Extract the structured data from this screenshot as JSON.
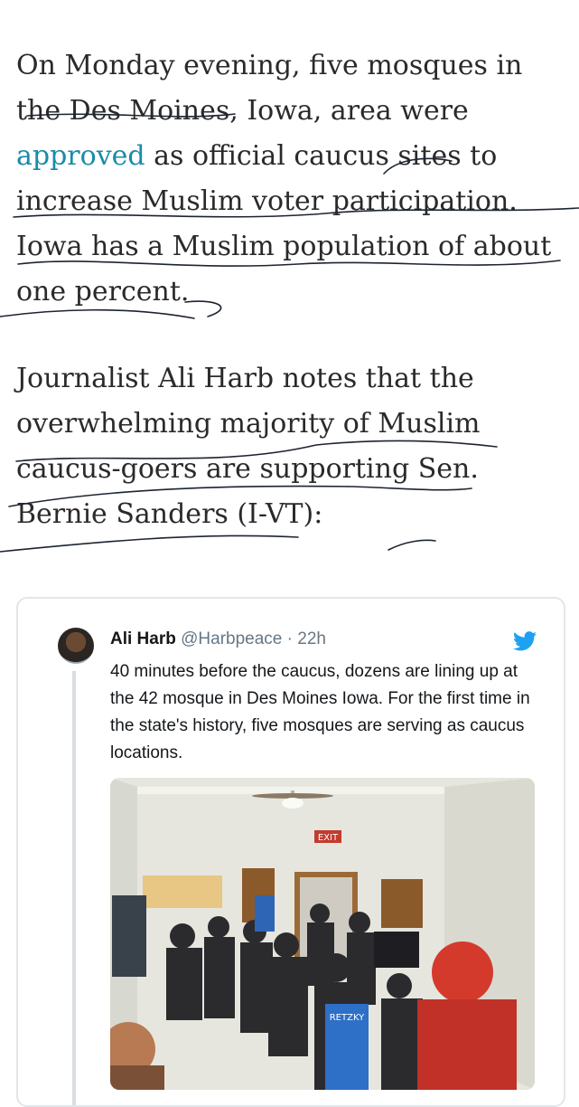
{
  "article": {
    "p1_before_link": "On Monday evening, five mosques in the Des Moines, Iowa, area were ",
    "p1_link": "approved",
    "p1_after_link": " as official caucus sites to increase Muslim voter participation. Iowa has a Muslim population of about one percent.",
    "p2": "Journalist Ali Harb notes that the overwhelming majority of Muslim caucus-goers are supporting Sen. Bernie Sanders (I-VT):"
  },
  "tweet": {
    "name": "Ali Harb",
    "handle": "@Harbpeace",
    "separator": " · ",
    "time": "22h",
    "text": "40 minutes before the caucus, dozens are lining up at the 42 mosque in Des Moines Iowa. For the first time in the state's history, five mosques are serving as caucus locations.",
    "photo_sign_exit": "EXIT",
    "photo_shirt_text": "RETZKY",
    "icon": "twitter-bird-icon"
  },
  "colors": {
    "link": "#1a8ba8",
    "twitter_blue": "#1da1f2",
    "text": "#2a2a2a",
    "scribble": "#1c2430"
  }
}
